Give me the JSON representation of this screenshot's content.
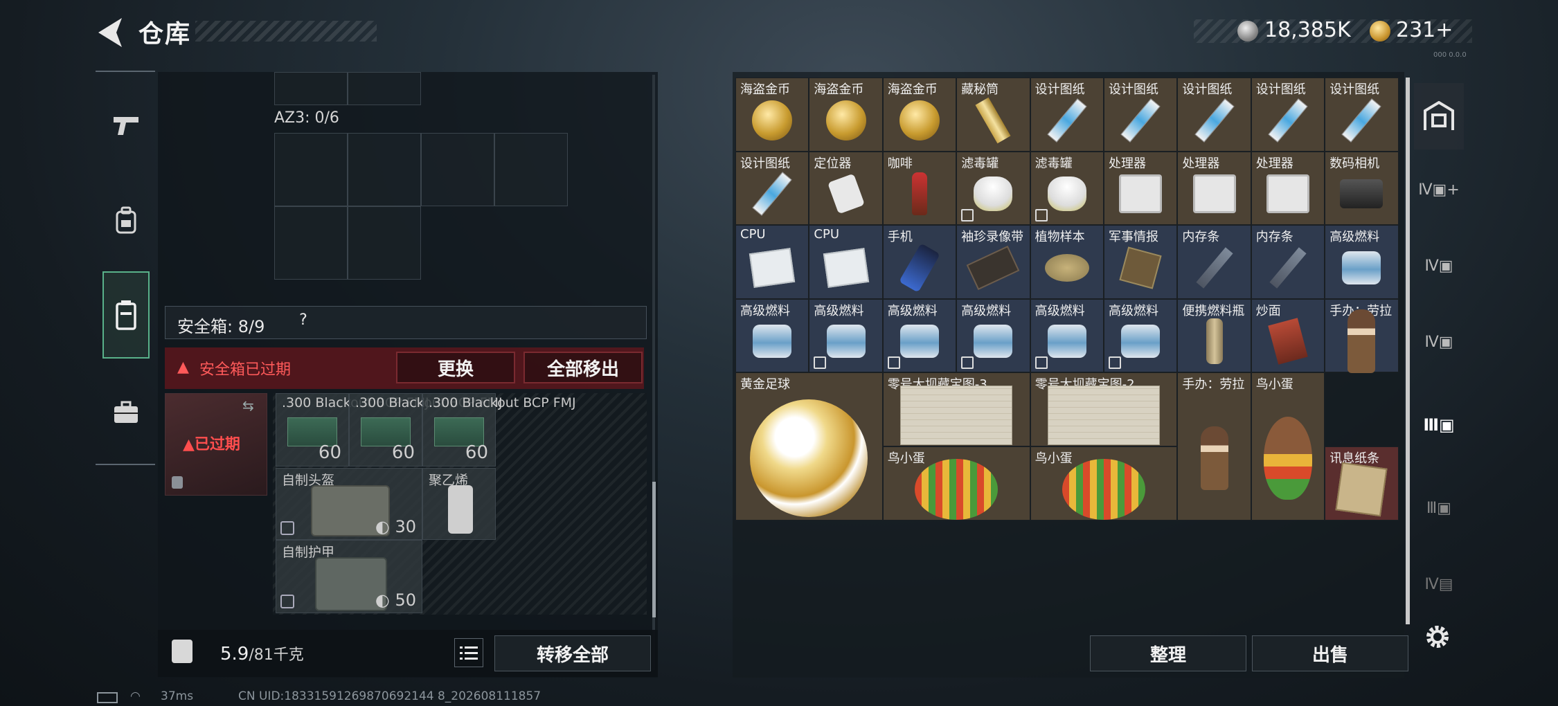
{
  "header": {
    "title": "仓库",
    "silver": "18,385K",
    "gold": "231+",
    "version": "000 0.0.0"
  },
  "nav": {
    "items": [
      "weapon-icon",
      "backpack-icon",
      "safe-box-icon",
      "briefcase-icon"
    ]
  },
  "left": {
    "az3_label": "AZ3: 0/6",
    "safe_label": "安全箱: 8/9",
    "safe_help": "?",
    "alert_text": "安全箱已过期",
    "replace_btn": "更换",
    "move_all_btn": "全部移出",
    "expired_tag": "已过期",
    "items": [
      {
        "name": ".300 Blackout BCP FMJ",
        "count": "60"
      },
      {
        "name": ".300 Blackout BCP FMJ",
        "count": "60"
      },
      {
        "name": ".300 Blackout BCP FMJ",
        "count": "60"
      },
      {
        "name": "自制头盔",
        "durability": "30"
      },
      {
        "name": "聚乙烯"
      },
      {
        "name": "自制护甲",
        "durability": "50"
      }
    ],
    "weight_value": "5.9",
    "weight_max": "/81千克",
    "transfer_all": "转移全部"
  },
  "stash": {
    "rows": [
      [
        "海盗金币",
        "海盗金币",
        "海盗金币",
        "藏秘筒",
        "设计图纸",
        "设计图纸",
        "设计图纸",
        "设计图纸",
        "设计图纸"
      ],
      [
        "设计图纸",
        "定位器",
        "咖啡",
        "滤毒罐",
        "滤毒罐",
        "处理器",
        "处理器",
        "处理器",
        "数码相机"
      ],
      [
        "CPU",
        "CPU",
        "手机",
        "袖珍录像带",
        "植物样本",
        "军事情报",
        "内存条",
        "内存条",
        "高级燃料"
      ],
      [
        "高级燃料",
        "高级燃料",
        "高级燃料",
        "高级燃料",
        "高级燃料",
        "高级燃料",
        "便携燃料瓶",
        "炒面",
        "手办：劳拉"
      ]
    ],
    "big": {
      "gold_ball": "黄金足球",
      "map1": "零号大坝藏宝图-3",
      "map2": "零号大坝藏宝图-2",
      "lara2": "手办：劳拉",
      "bird1": "鸟小蛋",
      "egg1": "鸟小蛋",
      "egg2": "鸟小蛋",
      "note": "讯息纸条"
    },
    "sort_btn": "整理",
    "sell_btn": "出售"
  },
  "status": {
    "ping": "37ms",
    "uid": "CN UID:18331591269870692144 8_202608111857"
  },
  "colors": {
    "accent_green": "#59b28a",
    "alert_red": "#ff5a5a",
    "cell_brown": "#4c4234",
    "cell_blue": "#2f3a4e"
  }
}
